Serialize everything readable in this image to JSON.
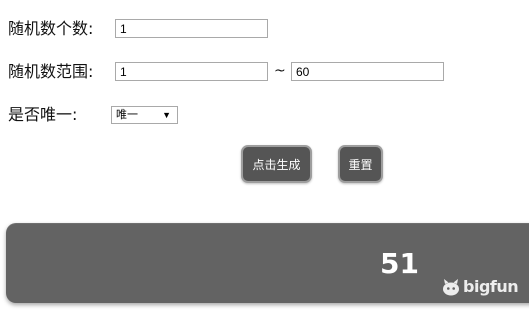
{
  "form": {
    "count_label": "随机数个数:",
    "count_value": "1",
    "range_label": "随机数范围:",
    "range_min": "1",
    "range_separator": "~",
    "range_max": "60",
    "unique_label": "是否唯一:",
    "unique_selected": "唯一"
  },
  "buttons": {
    "generate_label": "点击生成",
    "reset_label": "重置"
  },
  "result": {
    "value": "51"
  },
  "watermark": {
    "text": "bigfun",
    "icon": "bigfun-logo-icon"
  },
  "colors": {
    "button_bg": "#555555",
    "panel_bg": "#636363"
  }
}
